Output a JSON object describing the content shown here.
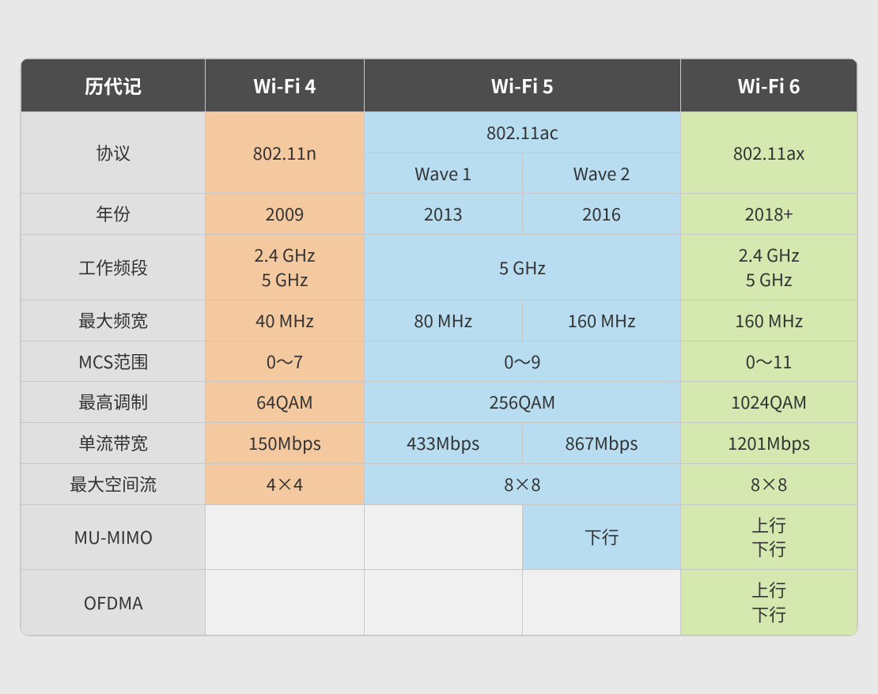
{
  "header": {
    "col_label": "历代记",
    "wifi4": "Wi-Fi 4",
    "wifi5": "Wi-Fi 5",
    "wifi6": "Wi-Fi 6"
  },
  "subheader": {
    "wave1": "Wave 1",
    "wave2": "Wave 2"
  },
  "rows": [
    {
      "label": "协议",
      "wifi4": "802.11n",
      "wifi5_both": "802.11ac",
      "wave1": "Wave 1",
      "wave2": "Wave 2",
      "wifi6": "802.11ax"
    },
    {
      "label": "年份",
      "wifi4": "2009",
      "wave1": "2013",
      "wave2": "2016",
      "wifi6": "2018+"
    },
    {
      "label": "工作频段",
      "wifi4": "2.4 GHz\n5 GHz",
      "wifi5_both": "5 GHz",
      "wifi6": "2.4 GHz\n5 GHz"
    },
    {
      "label": "最大频宽",
      "wifi4": "40 MHz",
      "wave1": "80 MHz",
      "wave2": "160 MHz",
      "wifi6": "160 MHz"
    },
    {
      "label": "MCS范围",
      "wifi4": "0～7",
      "wifi5_both": "0～9",
      "wifi6": "0～11"
    },
    {
      "label": "最高调制",
      "wifi4": "64QAM",
      "wifi5_both": "256QAM",
      "wifi6": "1024QAM"
    },
    {
      "label": "单流带宽",
      "wifi4": "150Mbps",
      "wave1": "433Mbps",
      "wave2": "867Mbps",
      "wifi6": "1201Mbps"
    },
    {
      "label": "最大空间流",
      "wifi4": "4×4",
      "wifi5_both": "8×8",
      "wifi6": "8×8"
    },
    {
      "label": "MU-MIMO",
      "wifi4": "",
      "wave1": "",
      "wave2": "下行",
      "wifi6": "上行\n下行"
    },
    {
      "label": "OFDMA",
      "wifi4": "",
      "wave1": "",
      "wave2": "",
      "wifi6": "上行\n下行"
    }
  ]
}
